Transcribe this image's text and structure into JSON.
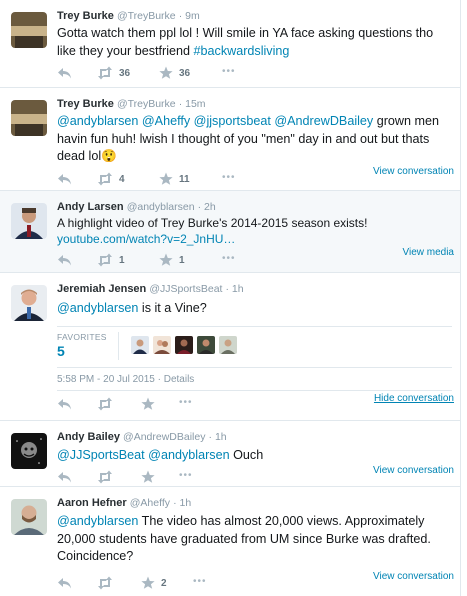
{
  "tweets": [
    {
      "name": "Trey Burke",
      "handle": "@TreyBurke",
      "time": "· 9m",
      "text_plain": "Gotta watch them ppl lol ! Will smile in YA face asking questions tho like they your bestfriend ",
      "text_tag": "#backwardsliving",
      "retweets": "36",
      "favorites": "36"
    },
    {
      "name": "Trey Burke",
      "handle": "@TreyBurke",
      "time": "· 15m",
      "mentions": "@andyblarsen @Aheffy @jjsportsbeat @AndrewDBailey",
      "text_plain": " grown men havin fun huh! lwish I thought of you \"men\" day in and out but thats dead lol",
      "emoji": "😲",
      "retweets": "4",
      "favorites": "11",
      "view_label": "View conversation"
    },
    {
      "name": "Andy Larsen",
      "handle": "@andyblarsen",
      "time": "· 2h",
      "text_plain": "A highlight video of Trey Burke's 2014-2015 season exists! ",
      "link_text": "youtube.com/watch?v=2_JnHU…",
      "retweets": "1",
      "favorites": "1",
      "view_label": "View media"
    },
    {
      "name": "Jeremiah Jensen",
      "handle": "@JJSportsBeat",
      "time": "· 1h",
      "mention": "@andyblarsen",
      "text_plain": " is it a Vine?",
      "fav_label": "FAVORITES",
      "fav_count": "5",
      "timestamp": "5:58 PM - 20 Jul 2015 · Details",
      "view_label": "Hide conversation"
    },
    {
      "name": "Andy Bailey",
      "handle": "@AndrewDBailey",
      "time": "· 1h",
      "mentions": "@JJSportsBeat @andyblarsen",
      "text_plain": " Ouch",
      "view_label": "View conversation"
    },
    {
      "name": "Aaron Hefner",
      "handle": "@Aheffy",
      "time": "· 1h",
      "mention": "@andyblarsen",
      "text_plain": " The video has almost 20,000 views. Approximately 20,000 students have graduated from UM since Burke was drafted. Coincidence?",
      "favorites": "2",
      "view_label": "View conversation"
    }
  ],
  "more_label": "•••",
  "colors": {
    "link": "#0084b4",
    "muted": "#8899a6",
    "border": "#e1e8ed",
    "selected_bg": "#f5f8fa"
  }
}
